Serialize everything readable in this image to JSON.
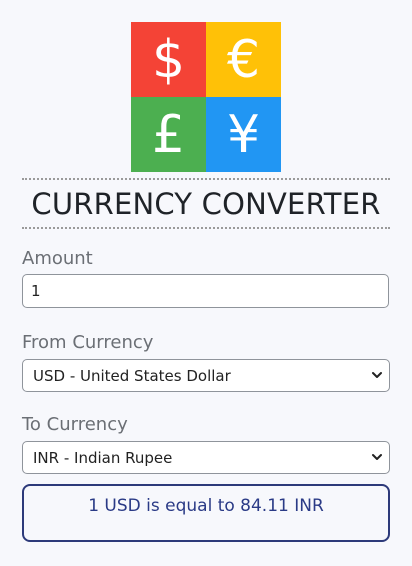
{
  "logo": {
    "tiles": [
      {
        "symbol": "$",
        "color": "#f44336"
      },
      {
        "symbol": "€",
        "color": "#ffc107"
      },
      {
        "symbol": "£",
        "color": "#4caf50"
      },
      {
        "symbol": "¥",
        "color": "#2196f3"
      }
    ]
  },
  "title": "CURRENCY CONVERTER",
  "amount": {
    "label": "Amount",
    "value": "1"
  },
  "from": {
    "label": "From Currency",
    "selected": "USD - United States Dollar"
  },
  "to": {
    "label": "To Currency",
    "selected": "INR - Indian Rupee"
  },
  "result": {
    "text": "1 USD is equal to 84.11 INR"
  },
  "icons": {
    "dropdown": "chevron-down-icon"
  }
}
